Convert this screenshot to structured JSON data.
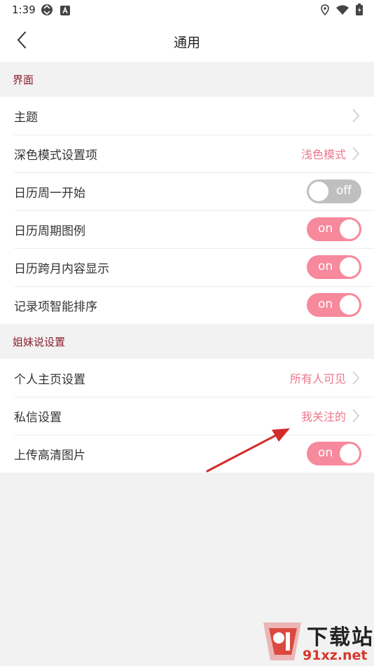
{
  "status_bar": {
    "time": "1:39"
  },
  "nav": {
    "title": "通用"
  },
  "sections": [
    {
      "header": "界面",
      "rows": [
        {
          "label": "主题",
          "type": "link",
          "value": ""
        },
        {
          "label": "深色模式设置项",
          "type": "link",
          "value": "浅色模式"
        },
        {
          "label": "日历周一开始",
          "type": "toggle",
          "state": "off",
          "toggle_text": "off"
        },
        {
          "label": "日历周期图例",
          "type": "toggle",
          "state": "on",
          "toggle_text": "on"
        },
        {
          "label": "日历跨月内容显示",
          "type": "toggle",
          "state": "on",
          "toggle_text": "on"
        },
        {
          "label": "记录项智能排序",
          "type": "toggle",
          "state": "on",
          "toggle_text": "on"
        }
      ]
    },
    {
      "header": "姐妹说设置",
      "rows": [
        {
          "label": "个人主页设置",
          "type": "link",
          "value": "所有人可见"
        },
        {
          "label": "私信设置",
          "type": "link",
          "value": "我关注的"
        },
        {
          "label": "上传高清图片",
          "type": "toggle",
          "state": "on",
          "toggle_text": "on"
        }
      ]
    }
  ],
  "watermark": {
    "logo_text": "91",
    "title": "下载站",
    "domain": "91xz.net"
  },
  "colors": {
    "accent": "#f7899c",
    "value_text": "#f0758b",
    "section_header_text": "#8a1f2e",
    "background": "#f2f2f2",
    "toggle_off": "#bfbfbf",
    "annotation_arrow": "#d42a2a"
  }
}
